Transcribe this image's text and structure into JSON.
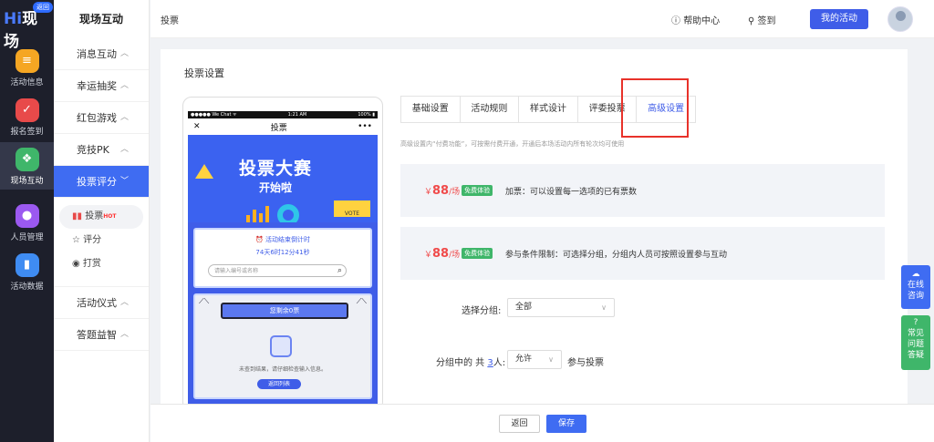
{
  "colors": {
    "accent": "#3f5de8",
    "rail_bg": "#1d1f2b",
    "free_badge": "#3fb66a",
    "price": "#f04a4a",
    "highlight_box": "#e8322a"
  },
  "logo": {
    "text": "现场",
    "hi": "Hi",
    "back": "返回"
  },
  "rail": [
    {
      "label": "活动信息",
      "icon": "list-icon",
      "color": "#f5a623"
    },
    {
      "label": "报名签到",
      "icon": "clipboard-icon",
      "color": "#e84a4a"
    },
    {
      "label": "现场互动",
      "icon": "interact-icon",
      "color": "#3fb66a"
    },
    {
      "label": "人员管理",
      "icon": "user-icon",
      "color": "#9b59f0"
    },
    {
      "label": "活动数据",
      "icon": "bar-chart-icon",
      "color": "#3f8cf2"
    }
  ],
  "sub": {
    "title": "现场互动",
    "items": [
      "消息互动",
      "幸运抽奖",
      "红包游戏",
      "竞技PK",
      "投票评分"
    ],
    "leaves": [
      "投票",
      "评分",
      "打赏"
    ],
    "hot": "HOT",
    "items2": [
      "活动仪式",
      "答题益智"
    ]
  },
  "topbar": {
    "breadcrumb": "投票",
    "help": "帮助中心",
    "signin": "签到",
    "my_activity": "我的活动"
  },
  "card": {
    "title": "投票设置"
  },
  "phone": {
    "carrier": "●●●●● We Chat ᯤ",
    "time": "1:21 AM",
    "battery": "100% ▮",
    "nav_title": "投票",
    "nav_close": "✕",
    "nav_more": "•••",
    "banner_line1": "投票大赛",
    "banner_line2": "开始啦",
    "vote_label": "VOTE",
    "countdown_label": "⏰ 活动结束倒计时",
    "countdown_time": "74天6时12分41秒",
    "search_placeholder": "请输入编号或名称",
    "remaining": "您剩余0票",
    "no_result": "未查到结果，请仔细检查输入信息。",
    "back_list": "返回列表"
  },
  "tabs": [
    "基础设置",
    "活动规则",
    "样式设计",
    "评委投票",
    "高级设置"
  ],
  "hint": "高级设置内“付费功能”，可按需付费开通，开通后本场活动内所有轮次均可使用",
  "features": [
    {
      "price": "88",
      "currency": "￥",
      "unit": "/场",
      "badge": "免费体验",
      "desc": "加票：可以设置每一选项的已有票数"
    },
    {
      "price": "88",
      "currency": "￥",
      "unit": "/场",
      "badge": "免费体验",
      "desc": "参与条件限制：可选择分组，分组内人员可按照设置参与互动"
    }
  ],
  "group": {
    "label": "选择分组:",
    "value": "全部",
    "count_prefix": "分组中的 共",
    "count": "3",
    "count_suffix": "人:",
    "allow": "允许",
    "participate": "参与投票"
  },
  "bottom": {
    "back": "返回",
    "save": "保存"
  },
  "float": {
    "online": "在线咨询",
    "faq": "常见问题答疑"
  }
}
